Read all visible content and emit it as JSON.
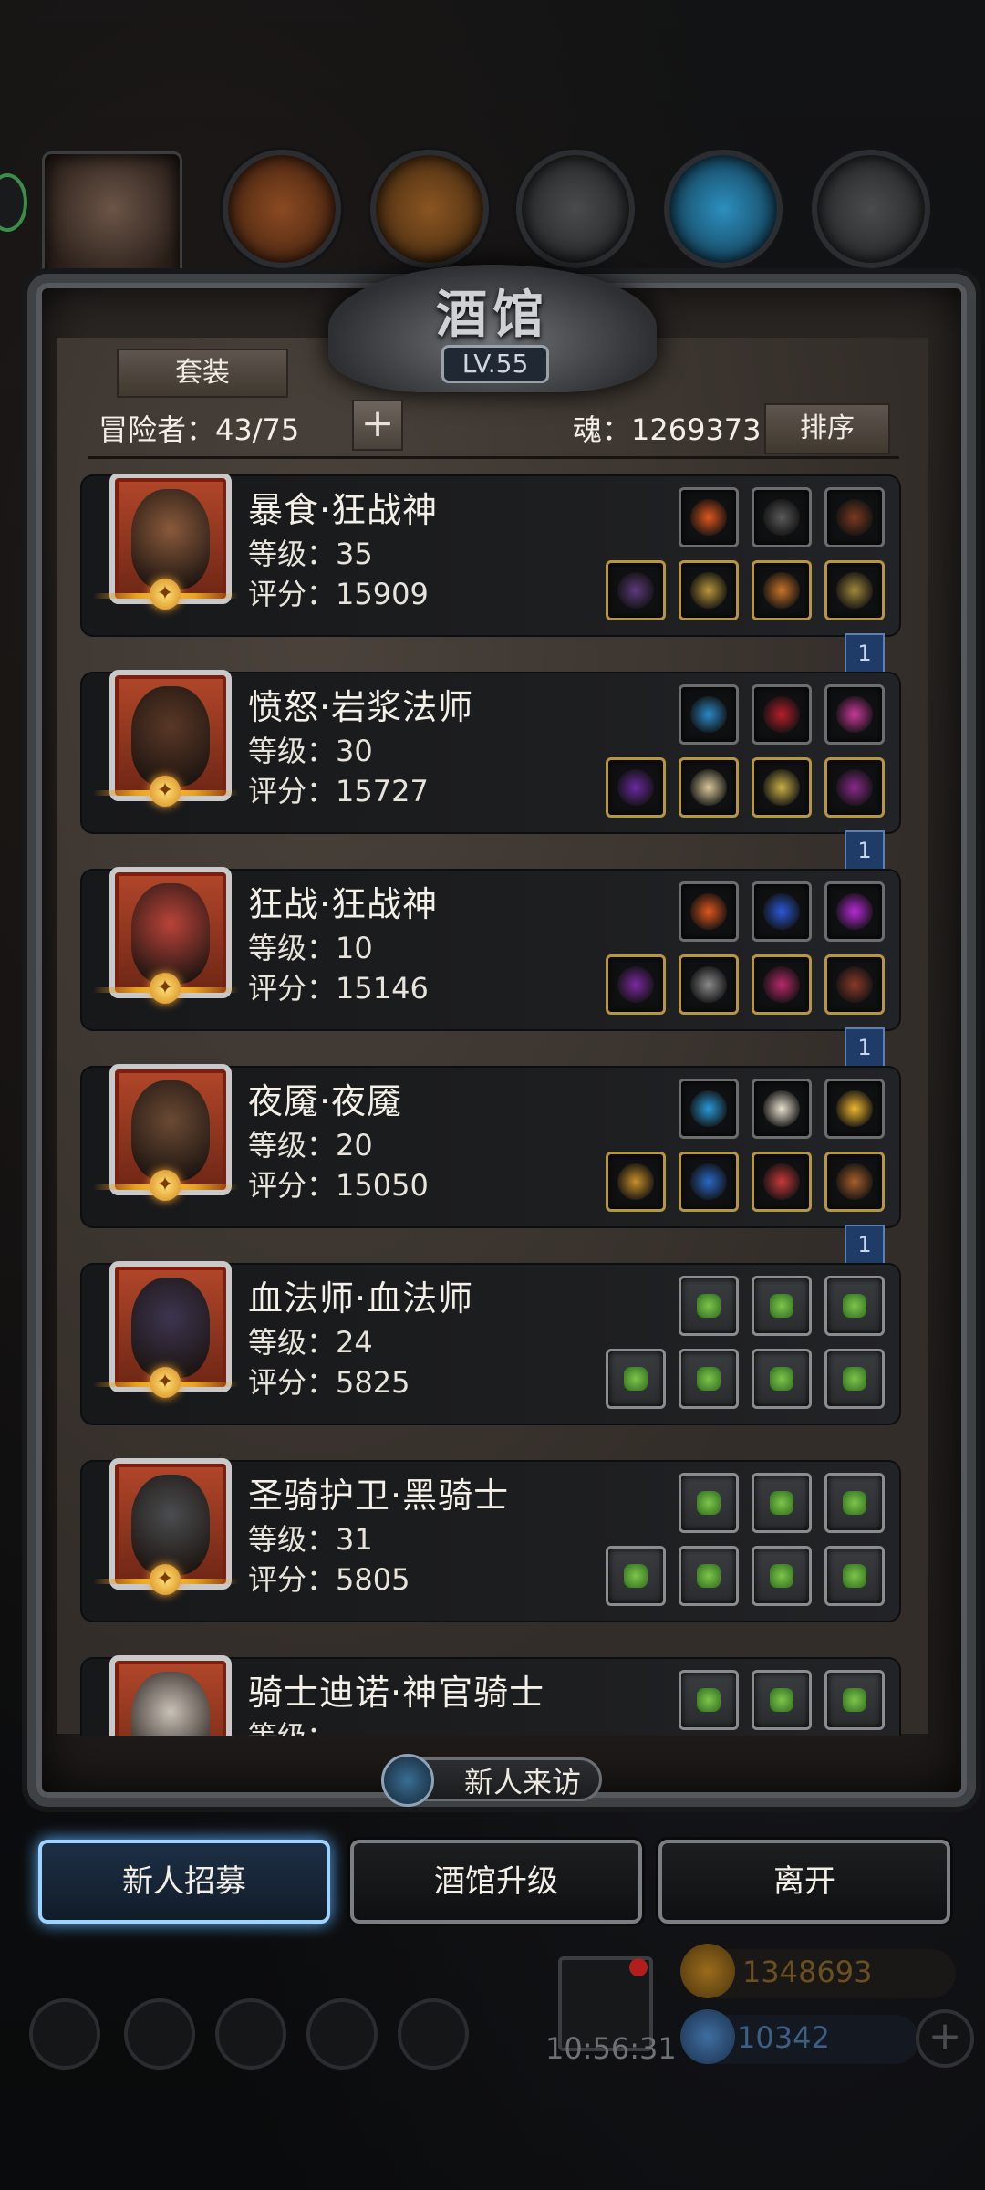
{
  "tavern": {
    "title": "酒馆",
    "level": "LV.55",
    "suit_button": "套装",
    "adventurers_label": "冒险者：43/75",
    "add_button": "+",
    "soul_label": "魂：1269373",
    "sort_button": "排序"
  },
  "heroes": [
    {
      "name": "暴食·狂战神",
      "level": "等级：35",
      "score": "评分：15909",
      "ribbon": "1",
      "face": "#8a5a3c"
    },
    {
      "name": "愤怒·岩浆法师",
      "level": "等级：30",
      "score": "评分：15727",
      "ribbon": "1",
      "face": "#5a3826"
    },
    {
      "name": "狂战·狂战神",
      "level": "等级：10",
      "score": "评分：15146",
      "ribbon": "1",
      "face": "#b9443a"
    },
    {
      "name": "夜魇·夜魇",
      "level": "等级：20",
      "score": "评分：15050",
      "ribbon": "1",
      "face": "#6b4a34"
    },
    {
      "name": "血法师·血法师",
      "level": "等级：24",
      "score": "评分：5825",
      "face": "#3d3550"
    },
    {
      "name": "圣骑护卫·黑骑士",
      "level": "等级：31",
      "score": "评分：5805",
      "face": "#4b4d50"
    },
    {
      "name": "骑士迪诺·神官骑士",
      "level": "等级：…",
      "score": "",
      "face": "#c9c2b8"
    }
  ],
  "plaque": {
    "label": "新人来访"
  },
  "buttons": {
    "recruit": "新人招募",
    "upgrade": "酒馆升级",
    "leave": "离开"
  },
  "hud": {
    "time": "10:56:31",
    "gold": "1348693",
    "gems": "10342",
    "plus": "+"
  },
  "colors": {
    "accent": "#5fb4ff",
    "gold": "#e9a020",
    "frame": "#3f4245"
  }
}
